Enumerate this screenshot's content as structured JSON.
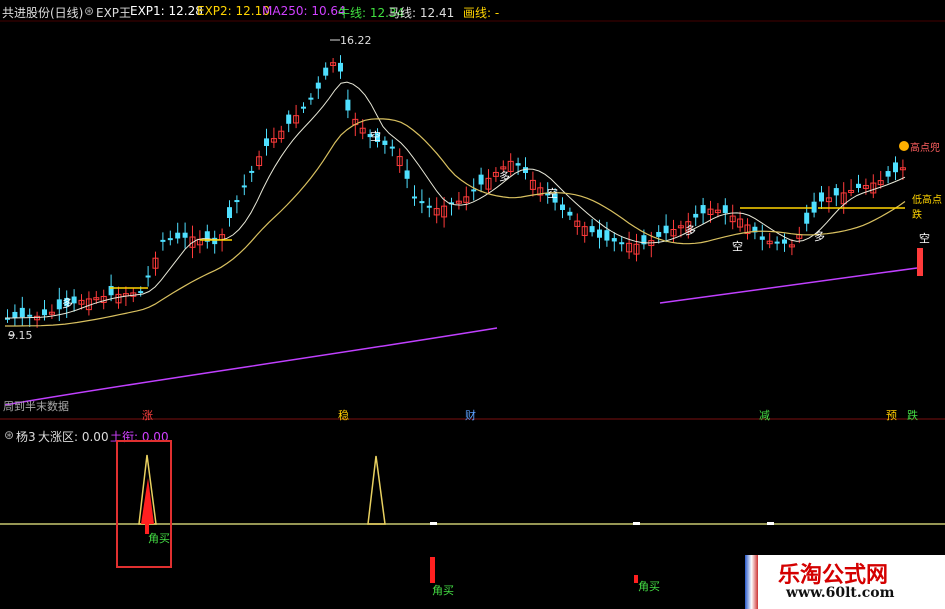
{
  "header": {
    "stock_name": "共进股份(日线)",
    "indicator": "EXP王",
    "exp1": "EXP1: 12.28",
    "exp2": "EXP2: 12.10",
    "ma250": "MA250: 10.64",
    "niu": "牛线: 12.34",
    "ma": "马线: 12.41",
    "huaxian": "画线: -"
  },
  "price_labels": {
    "high": "16.22",
    "low": "9.15",
    "note": "周到半末数据"
  },
  "markers": {
    "duo": "多",
    "kong": "空",
    "gao_dian": "高点兜",
    "di_gao": "低高点跌"
  },
  "signal_tags": [
    {
      "text": "涨",
      "color": "#ff4040"
    },
    {
      "text": "稳",
      "color": "#ffcc00"
    },
    {
      "text": "财",
      "color": "#5aa0ff"
    },
    {
      "text": "减",
      "color": "#44dd44"
    },
    {
      "text": "预",
      "color": "#ffcc00"
    },
    {
      "text": "跌",
      "color": "#44dd44"
    }
  ],
  "sub_header": {
    "name": "杨3",
    "zone": "大涨区: 0.00",
    "tuxie": "土衔: 0.00"
  },
  "sub_labels": {
    "buy1": "角买",
    "buy2": "角买",
    "buy3": "角买"
  },
  "watermark": {
    "title": "乐淘公式网",
    "url": "www.60lt.com"
  },
  "colors": {
    "up": "#ff3b3b",
    "down": "#4fe0ff",
    "ma_white": "#e8e8d8",
    "ma_yellow": "#d8c060",
    "ma250": "#c040ff",
    "yellow_line": "#ffd400"
  }
}
